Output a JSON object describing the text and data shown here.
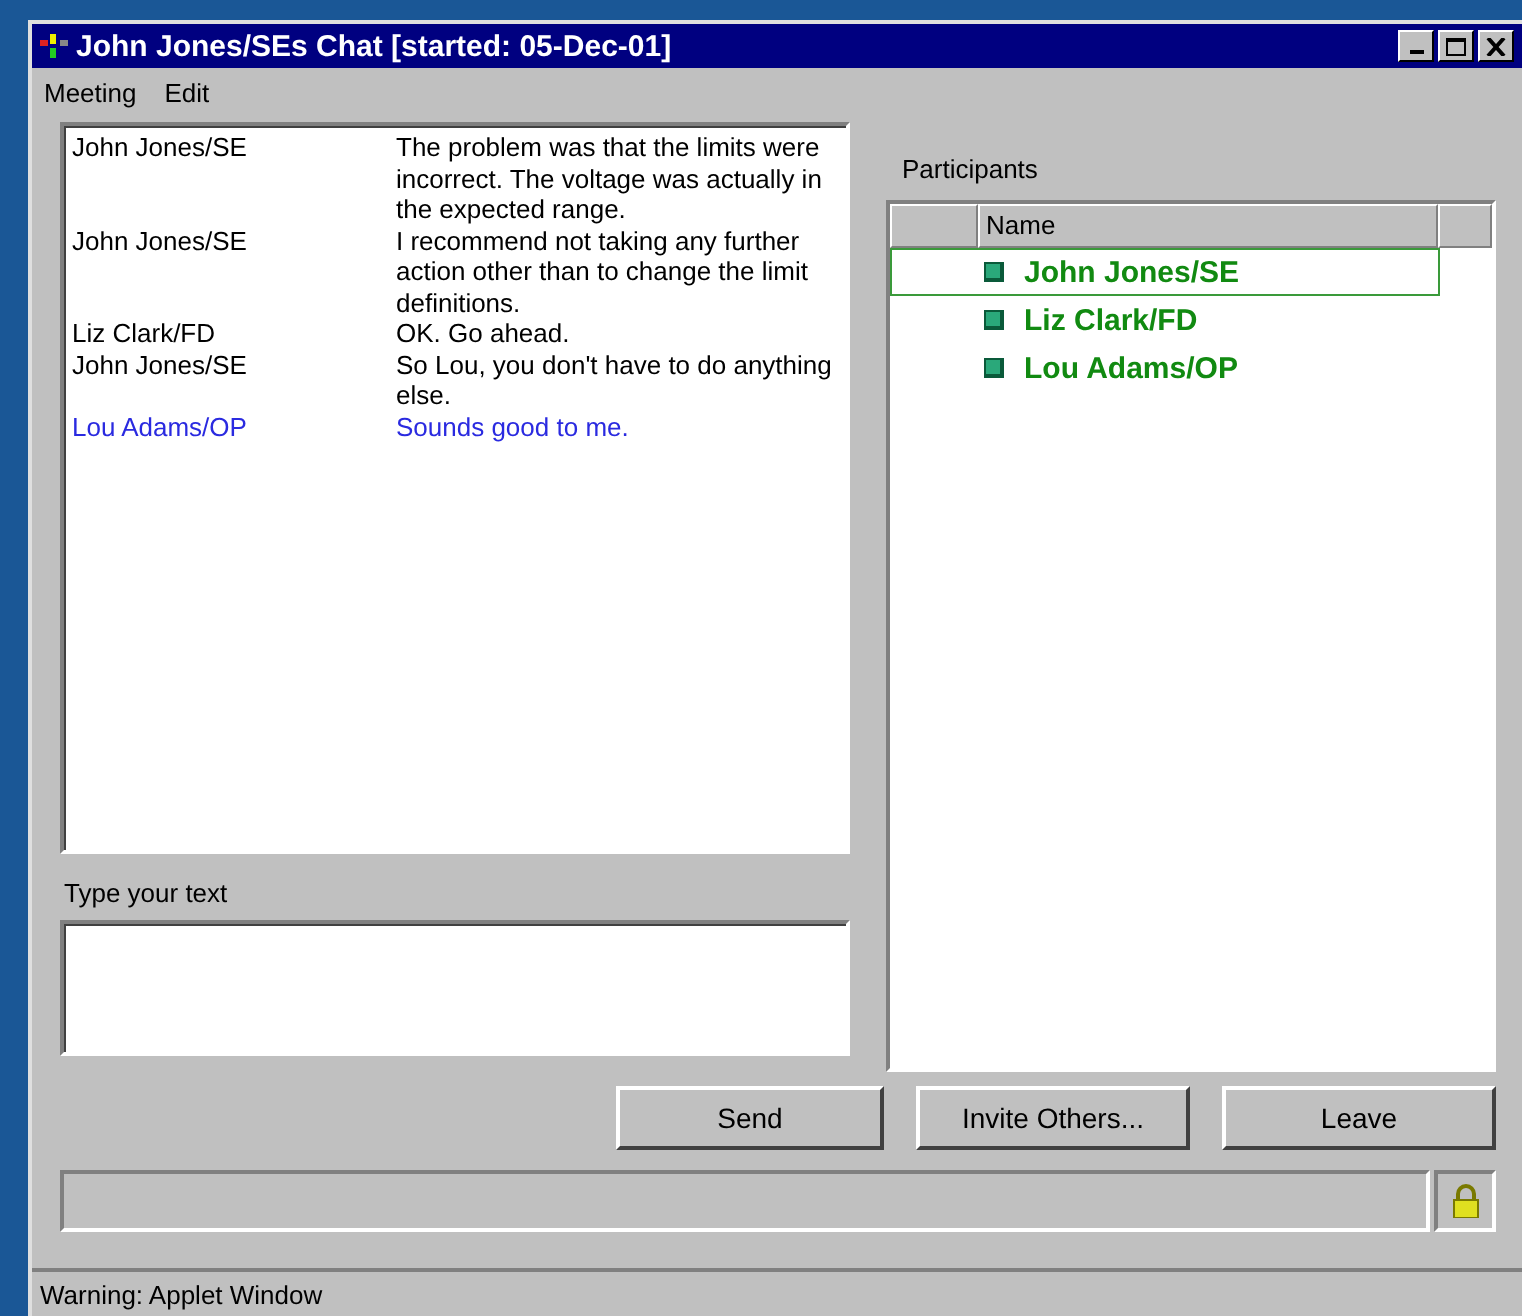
{
  "window": {
    "title": "John Jones/SEs Chat [started: 05-Dec-01]"
  },
  "menu": [
    "Meeting",
    "Edit"
  ],
  "messages": [
    {
      "sender": "John Jones/SE",
      "text": "The problem was that the limits were incorrect.  The voltage was actually in the expected range.",
      "color": "#000000"
    },
    {
      "sender": "John Jones/SE",
      "text": "I recommend not taking any further action other than to change the limit definitions.",
      "color": "#000000"
    },
    {
      "sender": "Liz Clark/FD",
      "text": "OK.  Go ahead.",
      "color": "#000000"
    },
    {
      "sender": "John Jones/SE",
      "text": "So Lou, you don't have to do anything else.",
      "color": "#000000"
    },
    {
      "sender": "Lou Adams/OP",
      "text": "Sounds good to me.",
      "color": "#2a2ae0"
    }
  ],
  "input": {
    "label": "Type your text"
  },
  "participants": {
    "label": "Participants",
    "column": "Name",
    "items": [
      {
        "name": "John Jones/SE",
        "selected": true
      },
      {
        "name": "Liz Clark/FD",
        "selected": false
      },
      {
        "name": "Lou Adams/OP",
        "selected": false
      }
    ]
  },
  "buttons": [
    "Send",
    "Invite Others...",
    "Leave"
  ],
  "status_bar": "Warning: Applet Window"
}
